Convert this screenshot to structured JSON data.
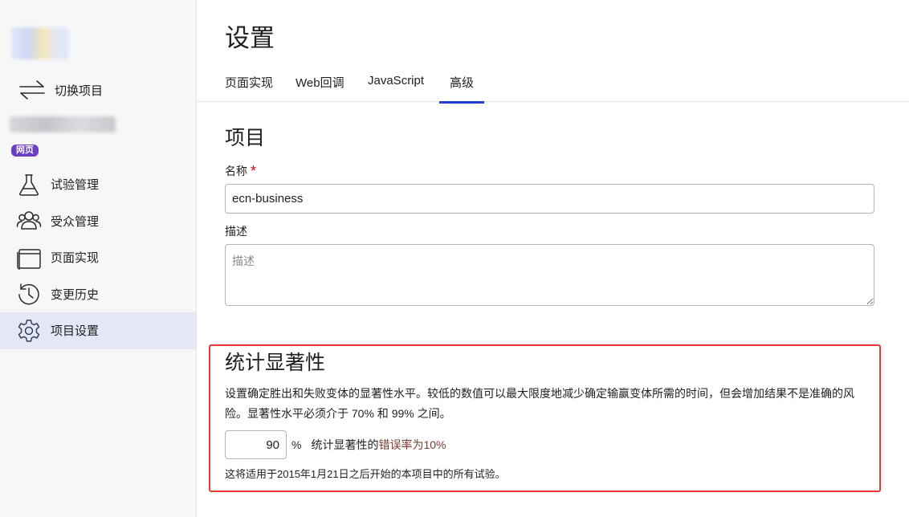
{
  "sidebar": {
    "switch_project_label": "切换项目",
    "project_badge": "网页",
    "items": [
      {
        "label": "试验管理",
        "icon": "flask-icon"
      },
      {
        "label": "受众管理",
        "icon": "audience-icon"
      },
      {
        "label": "页面实现",
        "icon": "browser-window-icon"
      },
      {
        "label": "变更历史",
        "icon": "history-icon"
      },
      {
        "label": "项目设置",
        "icon": "gear-icon",
        "active": true
      }
    ]
  },
  "main": {
    "title": "设置",
    "tabs": [
      {
        "label": "页面实现"
      },
      {
        "label": "Web回调"
      },
      {
        "label": "JavaScript"
      },
      {
        "label": "高级",
        "active": true
      }
    ],
    "project_section": {
      "title": "项目",
      "name_label": "名称",
      "name_required_mark": "*",
      "name_value": "ecn-business",
      "description_label": "描述",
      "description_placeholder": "描述"
    },
    "significance_section": {
      "title": "统计显著性",
      "description": "设置确定胜出和失败变体的显著性水平。较低的数值可以最大限度地减少确定输赢变体所需的时间，但会增加结果不是准确的风险。显著性水平必须介于 70% 和 99% 之间。",
      "value": "90",
      "percent_sign": "%",
      "error_prefix": "统计显著性的",
      "error_rate": "错误率为10%",
      "note": "这将适用于2015年1月21日之后开始的本项目中的所有试验。"
    }
  },
  "colors": {
    "accent": "#1f3fd6",
    "badge": "#6b3fc4",
    "highlight_border": "#e53935",
    "required": "#d6001c",
    "active_nav_bg": "#e4e8f6"
  }
}
